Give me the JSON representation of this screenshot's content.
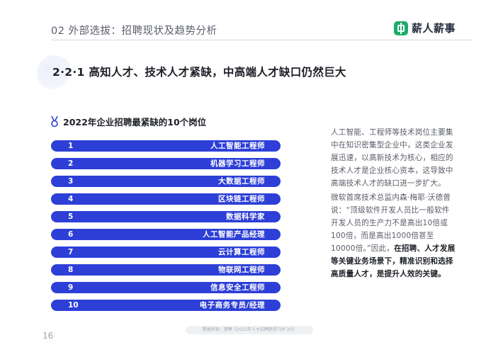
{
  "header": {
    "title": "02 外部选拔：招聘现状及趋势分析",
    "brand": "薪人薪事"
  },
  "section": {
    "title": "2·2·1 高知人才、技术人才紧缺，中高端人才缺口仍然巨大"
  },
  "chart_data": {
    "type": "table",
    "title": "2022年企业招聘最紧缺的10个岗位",
    "columns": [
      "rank",
      "position"
    ],
    "rows": [
      {
        "rank": "1",
        "name": "人工智能工程师"
      },
      {
        "rank": "2",
        "name": "机器学习工程师"
      },
      {
        "rank": "3",
        "name": "大数据工程师"
      },
      {
        "rank": "4",
        "name": "区块链工程师"
      },
      {
        "rank": "5",
        "name": "数据科学家"
      },
      {
        "rank": "6",
        "name": "人工智能产品经理"
      },
      {
        "rank": "7",
        "name": "云计算工程师"
      },
      {
        "rank": "8",
        "name": "物联网工程师"
      },
      {
        "rank": "9",
        "name": "信息安全工程师"
      },
      {
        "rank": "10",
        "name": "电子商务专员/经理"
      }
    ],
    "bar_color": "#2d3fd7"
  },
  "text": {
    "para1": "人工智能、工程师等技术岗位主要集中在知识密集型企业中，这类企业发展迅速，以高新技术为核心，相应的技术人才是企业核心资本，这导致中高端技术人才的缺口进一步扩大。",
    "para2_plain": "微软首席技术总监内森·梅耶·沃德曾说：“顶级软件开发人员比一般软件开发人员的生产力不是高出10倍或100倍，而是高出1000倍甚至10000倍。”因此，",
    "para2_bold": "在招聘、人才发展等关键业务场景下，精准识别和选择高质量人才，是提升人效的关键。"
  },
  "footer": {
    "page": "16",
    "source": "数据来源：猎聘《2022年人才招聘趋势TOP 20》"
  },
  "colors": {
    "accent": "#2d3fd7",
    "brand": "#1dab6b"
  },
  "icons": {
    "brand": "logo-icon",
    "list": "medal-icon"
  }
}
